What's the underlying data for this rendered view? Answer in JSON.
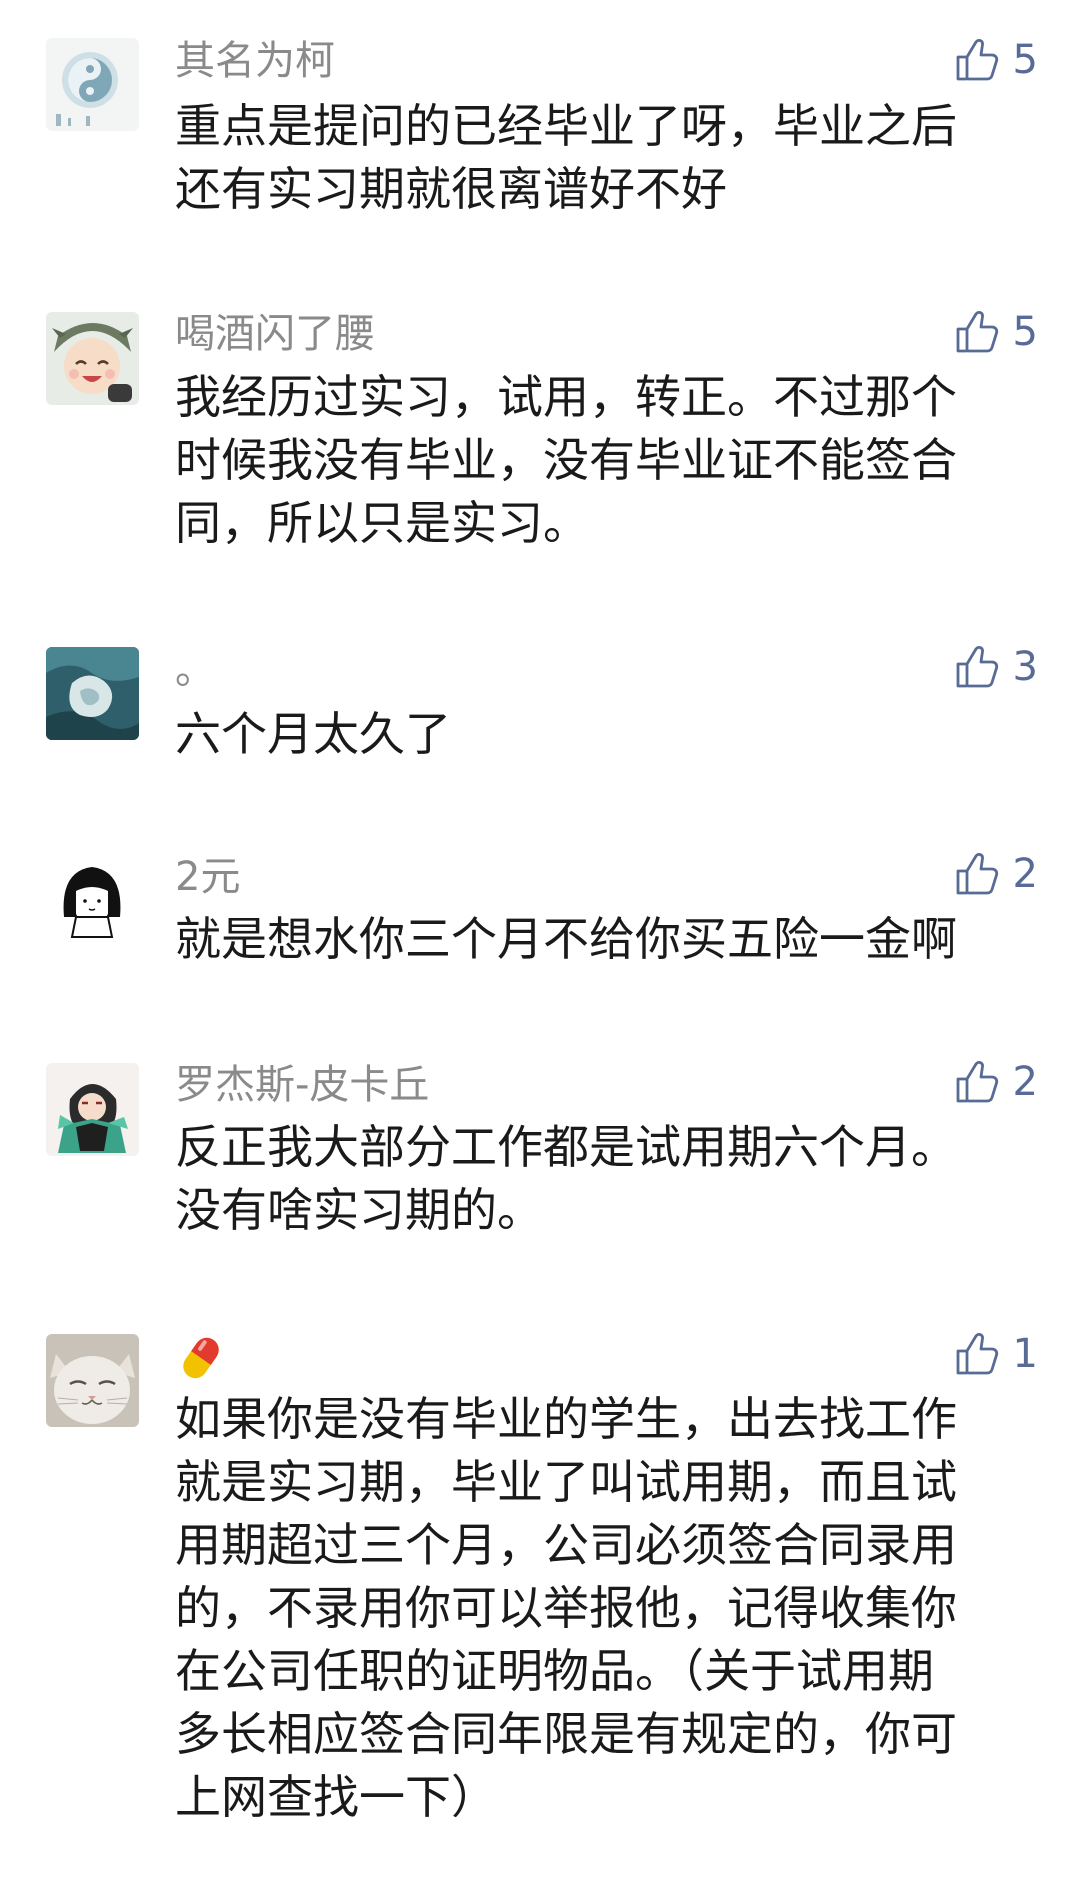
{
  "comments": [
    {
      "username": "其名为柯",
      "avatar_icon": "yin-yang-avatar",
      "likes": "5",
      "text": "重点是提问的已经毕业了呀，毕业之后\n还有实习期就很离谱好不好"
    },
    {
      "username": "喝酒闪了腰",
      "avatar_icon": "cartoon-girl-avatar",
      "likes": "5",
      "text": "我经历过实习，试用，转正。不过那个\n时候我没有毕业，没有毕业证不能签合\n同，所以只是实习。"
    },
    {
      "username": "。",
      "avatar_icon": "ice-water-avatar",
      "likes": "3",
      "text": "六个月太久了"
    },
    {
      "username": "2元",
      "avatar_icon": "black-hair-girl-avatar",
      "likes": "2",
      "text": "就是想水你三个月不给你买五险一金啊"
    },
    {
      "username": "罗杰斯-皮卡丘",
      "avatar_icon": "anime-character-avatar",
      "likes": "2",
      "text": "反正我大部分工作都是试用期六个月。\n没有啥实习期的。"
    },
    {
      "username": "",
      "username_icon": "pill-emoji",
      "avatar_icon": "cat-avatar",
      "likes": "1",
      "text": "如果你是没有毕业的学生，出去找工作\n就是实习期，毕业了叫试用期，而且试\n用期超过三个月，公司必须签合同录用\n的，不录用你可以举报他，记得收集你\n在公司任职的证明物品。（关于试用期\n多长相应签合同年限是有规定的，你可\n上网查找一下）"
    }
  ],
  "colors": {
    "username": "#8a8a8a",
    "text": "#1a1a1a",
    "like": "#576b95"
  },
  "icons": {
    "like": "thumbs-up-icon"
  }
}
